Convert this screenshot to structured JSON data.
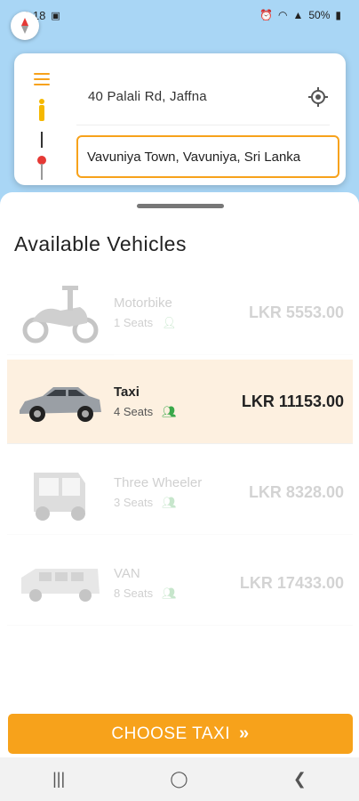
{
  "status_bar": {
    "time": "2:18",
    "battery": "50%"
  },
  "route": {
    "pickup": "40 Palali Rd, Jaffna",
    "destination": "Vavuniya Town, Vavuniya, Sri Lanka"
  },
  "sheet": {
    "title": "Available Vehicles",
    "vehicles": [
      {
        "name": "Motorbike",
        "seats": "1 Seats",
        "price": "LKR 5553.00",
        "selected": false
      },
      {
        "name": "Taxi",
        "seats": "4 Seats",
        "price": "LKR 11153.00",
        "selected": true
      },
      {
        "name": "Three Wheeler",
        "seats": "3 Seats",
        "price": "LKR 8328.00",
        "selected": false
      },
      {
        "name": "VAN",
        "seats": "8 Seats",
        "price": "LKR 17433.00",
        "selected": false
      }
    ]
  },
  "cta": {
    "label": "CHOOSE TAXI"
  },
  "colors": {
    "accent": "#f7a21b",
    "selected_bg": "#fdf0e0",
    "map_bg": "#a9d6f5",
    "seat_icon": "#3aa84a"
  },
  "icons": [
    "compass-icon",
    "menu-icon",
    "pickup-person-icon",
    "destination-pin-icon",
    "gps-target-icon",
    "person-icon",
    "double-chevron-right-icon",
    "recents-icon",
    "home-icon",
    "back-icon"
  ]
}
